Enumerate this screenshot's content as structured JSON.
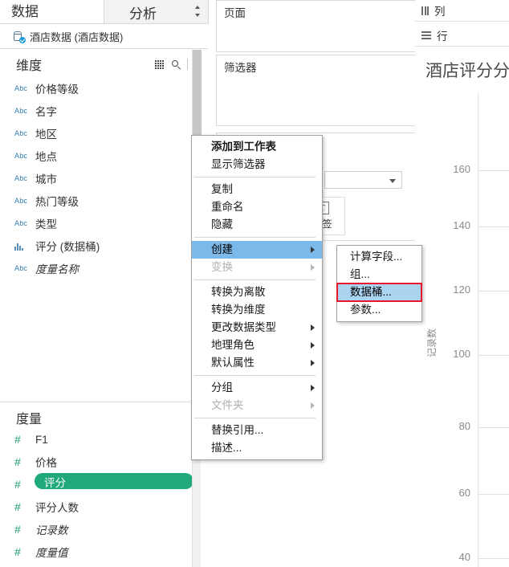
{
  "app": {
    "tabs": {
      "data": "数据",
      "analysis": "分析"
    },
    "data_source": {
      "name": "酒店数据 (酒店数据)",
      "icon": "database-icon"
    }
  },
  "dimensions_section": {
    "title": "维度",
    "icons": [
      "grid-icon",
      "search-icon",
      "chevron-down-icon"
    ],
    "fields": [
      {
        "icon": "abc",
        "label": "价格等级",
        "italic": false
      },
      {
        "icon": "abc",
        "label": "名字",
        "italic": false
      },
      {
        "icon": "abc",
        "label": "地区",
        "italic": false
      },
      {
        "icon": "abc",
        "label": "地点",
        "italic": false
      },
      {
        "icon": "abc",
        "label": "城市",
        "italic": false
      },
      {
        "icon": "abc",
        "label": "热门等级",
        "italic": false
      },
      {
        "icon": "abc",
        "label": "类型",
        "italic": false
      },
      {
        "icon": "bars",
        "label": "评分 (数据桶)",
        "italic": false
      },
      {
        "icon": "abc",
        "label": "度量名称",
        "italic": true
      }
    ]
  },
  "measures_section": {
    "title": "度量",
    "fields": [
      {
        "icon": "hash",
        "label": "F1",
        "italic": false,
        "selected": false
      },
      {
        "icon": "hash",
        "label": "价格",
        "italic": false,
        "selected": false
      },
      {
        "icon": "hash",
        "label": "评分",
        "italic": false,
        "selected": true
      },
      {
        "icon": "hash",
        "label": "评分人数",
        "italic": false,
        "selected": false
      },
      {
        "icon": "hash",
        "label": "记录数",
        "italic": true,
        "selected": false
      },
      {
        "icon": "hash",
        "label": "度量值",
        "italic": true,
        "selected": false
      }
    ]
  },
  "shelves": {
    "pages": "页面",
    "filters": "筛选器",
    "columns": "列",
    "rows": "行"
  },
  "marks": {
    "label_button": "标签",
    "label_icon": "text-label-icon"
  },
  "context_menu": {
    "items": [
      {
        "label": "添加到工作表",
        "bold": true,
        "disabled": false,
        "submenu": false,
        "selected": false
      },
      {
        "label": "显示筛选器",
        "bold": false,
        "disabled": false,
        "submenu": false,
        "selected": false
      },
      {
        "sep": true
      },
      {
        "label": "复制",
        "bold": false,
        "disabled": false,
        "submenu": false,
        "selected": false
      },
      {
        "label": "重命名",
        "bold": false,
        "disabled": false,
        "submenu": false,
        "selected": false
      },
      {
        "label": "隐藏",
        "bold": false,
        "disabled": false,
        "submenu": false,
        "selected": false
      },
      {
        "sep": true
      },
      {
        "label": "创建",
        "bold": false,
        "disabled": false,
        "submenu": true,
        "selected": true
      },
      {
        "label": "变换",
        "bold": false,
        "disabled": true,
        "submenu": true,
        "selected": false
      },
      {
        "sep": true
      },
      {
        "label": "转换为离散",
        "bold": false,
        "disabled": false,
        "submenu": false,
        "selected": false
      },
      {
        "label": "转换为维度",
        "bold": false,
        "disabled": false,
        "submenu": false,
        "selected": false
      },
      {
        "label": "更改数据类型",
        "bold": false,
        "disabled": false,
        "submenu": true,
        "selected": false
      },
      {
        "label": "地理角色",
        "bold": false,
        "disabled": false,
        "submenu": true,
        "selected": false
      },
      {
        "label": "默认属性",
        "bold": false,
        "disabled": false,
        "submenu": true,
        "selected": false
      },
      {
        "sep": true
      },
      {
        "label": "分组",
        "bold": false,
        "disabled": false,
        "submenu": true,
        "selected": false
      },
      {
        "label": "文件夹",
        "bold": false,
        "disabled": true,
        "submenu": true,
        "selected": false
      },
      {
        "sep": true
      },
      {
        "label": "替换引用...",
        "bold": false,
        "disabled": false,
        "submenu": false,
        "selected": false
      },
      {
        "label": "描述...",
        "bold": false,
        "disabled": false,
        "submenu": false,
        "selected": false
      }
    ]
  },
  "create_submenu": {
    "items": [
      {
        "label": "计算字段...",
        "highlighted": false
      },
      {
        "label": "组...",
        "highlighted": false
      },
      {
        "label": "数据桶...",
        "highlighted": true
      },
      {
        "label": "参数...",
        "highlighted": false
      }
    ]
  },
  "viz": {
    "title": "酒店评分分",
    "axis_title": "记录数"
  },
  "colors": {
    "selection_green": "#1fa97c",
    "menu_highlight": "#7db9e8",
    "annotation_red": "#e8152c",
    "abc_blue": "#2e7cb2",
    "hash_green": "#1f9d6b"
  },
  "chart_data": {
    "type": "bar",
    "title": "酒店评分分",
    "xlabel": "",
    "ylabel": "记录数",
    "ylim": [
      30,
      170
    ],
    "yticks": [
      160,
      140,
      120,
      100,
      80,
      60,
      40
    ],
    "categories": [],
    "values": [],
    "grid": true,
    "legend": "none",
    "note": "Only the y-axis of the bar chart is visible in the screenshot; plot area is cropped off-screen to the right."
  }
}
